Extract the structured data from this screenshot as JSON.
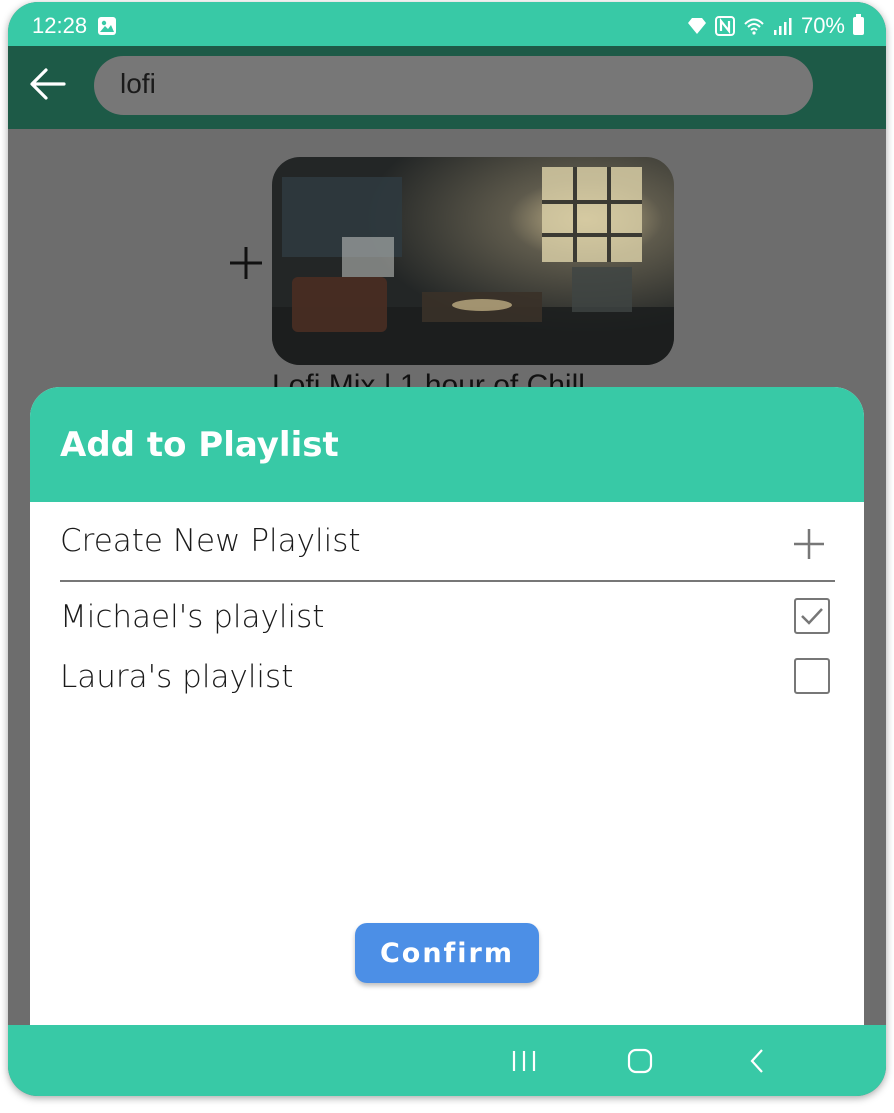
{
  "status_bar": {
    "time": "12:28",
    "battery_percent": "70%",
    "icons": [
      "image-notification-icon",
      "vpn-diamond-icon",
      "nfc-icon",
      "wifi-icon",
      "signal-icon",
      "battery-icon"
    ]
  },
  "app_bar": {
    "back_icon": "arrow-left-icon",
    "search_value": "lofi"
  },
  "result": {
    "add_icon": "plus-icon",
    "title": "Lofi Mix | 1 hour of Chill"
  },
  "dialog": {
    "title": "Add to Playlist",
    "create_label": "Create New Playlist",
    "playlists": [
      {
        "label": "Michael's playlist",
        "checked": true
      },
      {
        "label": "Laura's playlist",
        "checked": false
      }
    ],
    "confirm_label": "Confirm"
  },
  "colors": {
    "accent": "#38c9a6",
    "app_bar": "#1d5a47",
    "confirm": "#4c8fe6",
    "scrim": "#6d6d6d"
  },
  "nav_bar": {
    "icons": [
      "recents-icon",
      "home-icon",
      "back-chevron-icon"
    ]
  }
}
